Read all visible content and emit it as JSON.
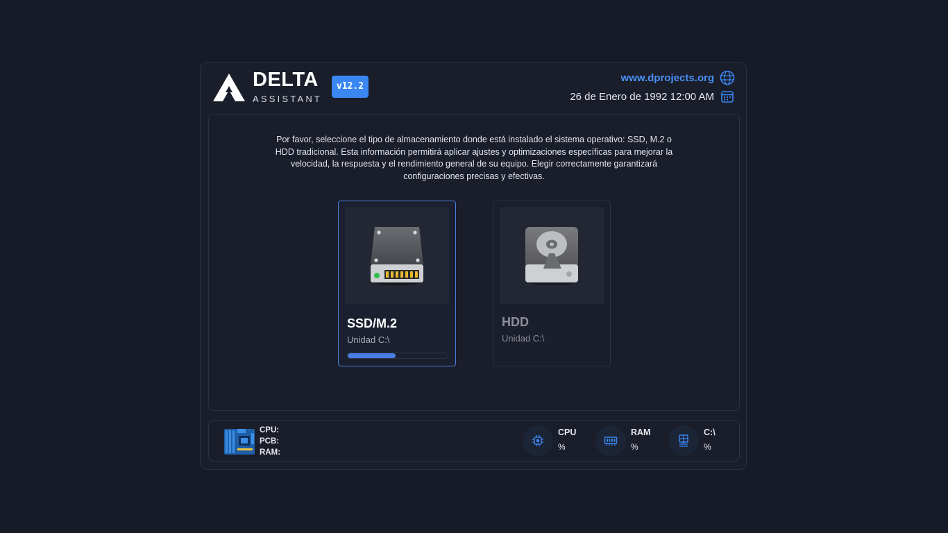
{
  "header": {
    "brand_name": "DELTA",
    "brand_sub": "ASSISTANT",
    "version": "v12.2",
    "site": "www.dprojects.org",
    "datetime": "26 de Enero de 1992  12:00 AM"
  },
  "main": {
    "description": "Por favor, seleccione el tipo de almacenamiento donde está instalado el sistema operativo: SSD, M.2 o HDD tradicional. Esta información permitirá aplicar ajustes y optimizaciones específicas para mejorar la velocidad, la respuesta y el rendimiento general de su equipo. Elegir correctamente garantizará configuraciones precisas y efectivas.",
    "cards": [
      {
        "title": "SSD/M.2",
        "subtitle": "Unidad C:\\",
        "selected": true,
        "progress_fraction": 0.48,
        "icon": "ssd-drive-icon"
      },
      {
        "title": "HDD",
        "subtitle": "Unidad C:\\",
        "selected": false,
        "icon": "hdd-drive-icon"
      }
    ]
  },
  "footer": {
    "specs": {
      "cpu_label": "CPU:",
      "pcb_label": "PCB:",
      "ram_label": "RAM:"
    },
    "stats": [
      {
        "label": "CPU",
        "value": "%",
        "icon": "cpu-icon"
      },
      {
        "label": "RAM",
        "value": "%",
        "icon": "ram-icon"
      },
      {
        "label": "C:\\",
        "value": "%",
        "icon": "disk-icon"
      }
    ]
  },
  "colors": {
    "background": "#171b27",
    "accent": "#3a86f2",
    "link": "#4a8ff5",
    "progress": "#4b7de6",
    "selected_border": "#4a7de0"
  }
}
